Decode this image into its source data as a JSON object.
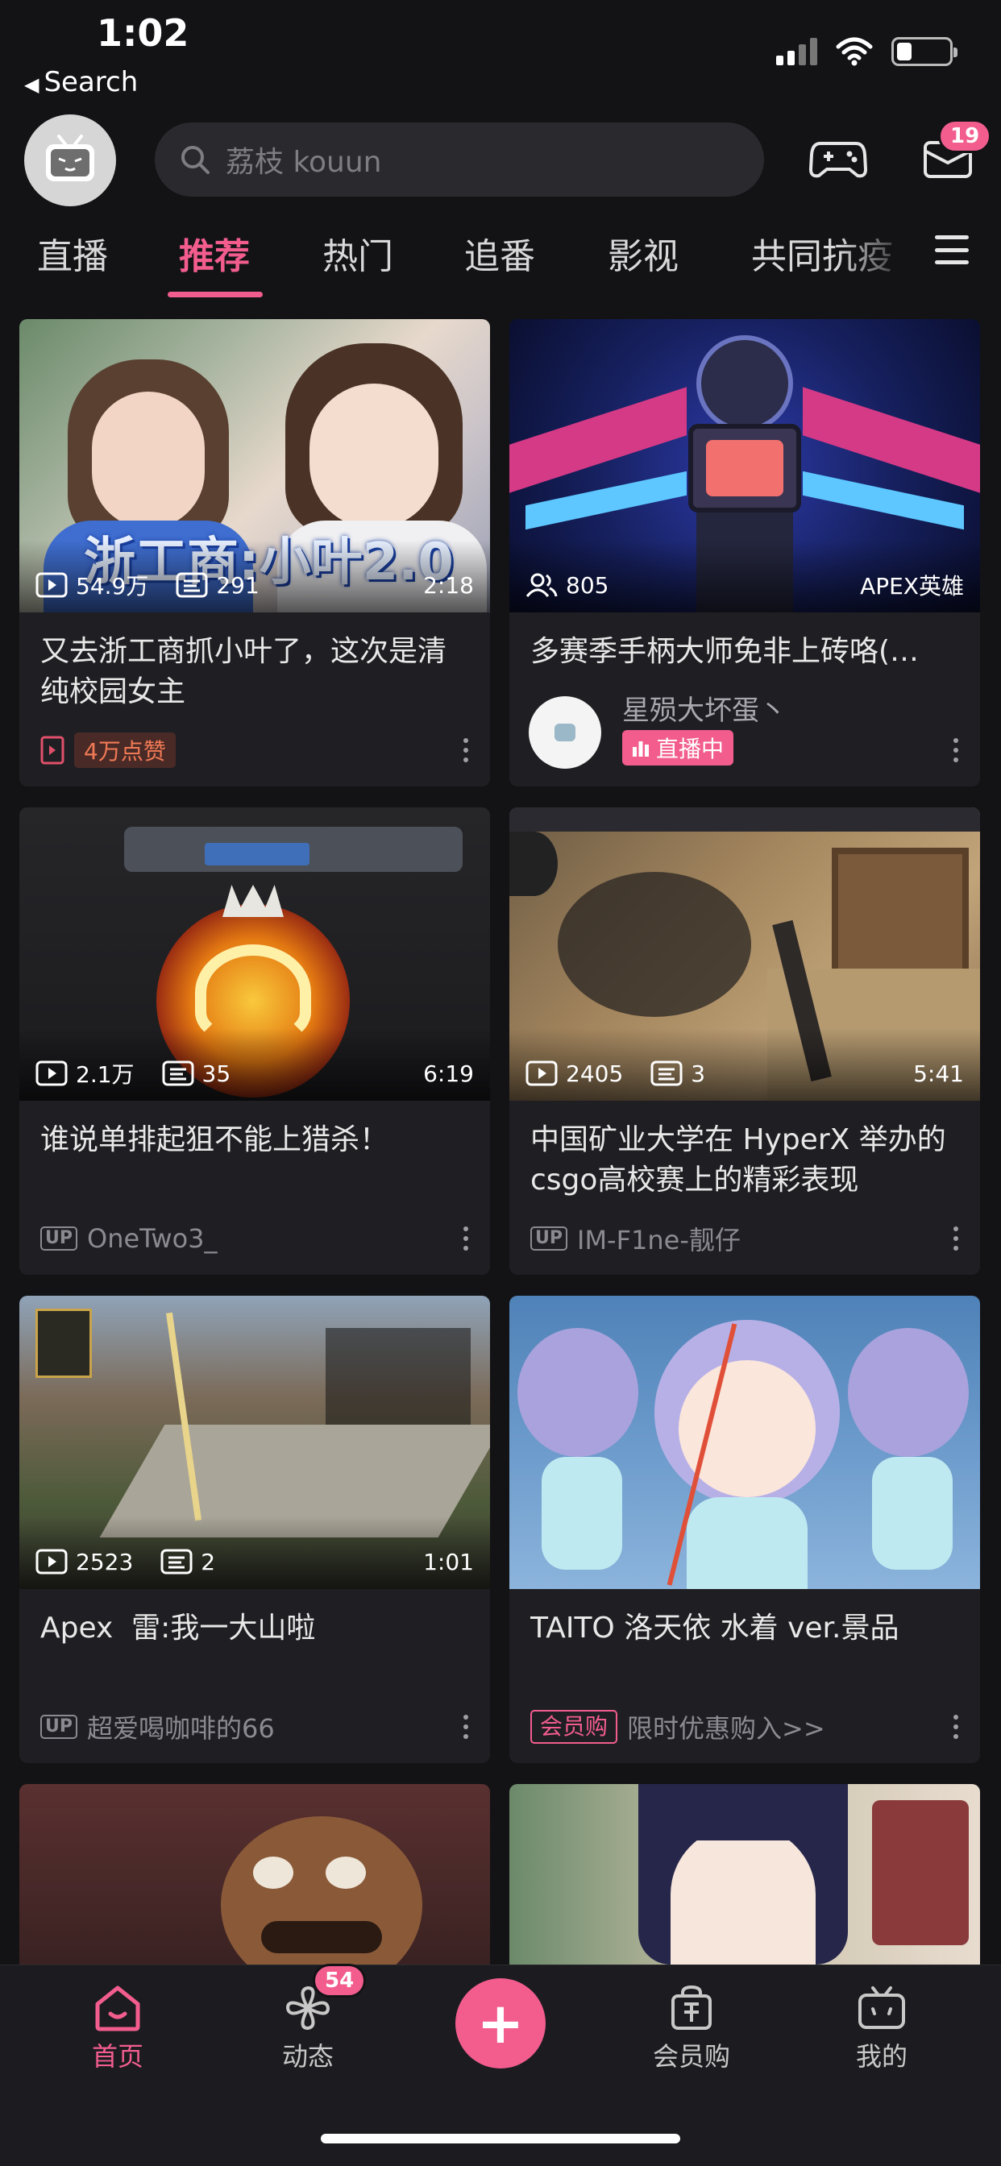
{
  "status_bar": {
    "time": "1:02",
    "back_label": "Search"
  },
  "header": {
    "search_placeholder": "荔枝 kouun",
    "messages_badge": "19"
  },
  "tabs": [
    {
      "label": "直播"
    },
    {
      "label": "推荐",
      "active": true
    },
    {
      "label": "热门"
    },
    {
      "label": "追番"
    },
    {
      "label": "影视"
    },
    {
      "label": "共同抗疫"
    }
  ],
  "feed": [
    {
      "views": "54.9万",
      "comments": "291",
      "duration": "2:18",
      "thumb_text": "浙工商:小叶2.0",
      "title": "又去浙工商抓小叶了，这次是清纯校园女主",
      "tag": "4万点赞"
    },
    {
      "viewers": "805",
      "category": "APEX英雄",
      "title": "多赛季手柄大师免非上砖咯(…",
      "streamer": "星殒大坏蛋丶",
      "live_label": "直播中"
    },
    {
      "views": "2.1万",
      "comments": "35",
      "duration": "6:19",
      "title": "谁说单排起狙不能上猎杀！",
      "up_name": "OneTwo3_"
    },
    {
      "views": "2405",
      "comments": "3",
      "duration": "5:41",
      "title": "中国矿业大学在 HyperX 举办的csgo高校赛上的精彩表现",
      "up_name": "IM-F1ne-靓仔"
    },
    {
      "views": "2523",
      "comments": "2",
      "duration": "1:01",
      "title": "Apex  雷:我一大山啦",
      "up_name": "超爱喝咖啡的66"
    },
    {
      "title": "TAITO 洛天依 水着 ver.景品",
      "promo_tag": "会员购",
      "promo_text": "限时优惠购入>>"
    }
  ],
  "up_label": "UP",
  "bottom_nav": {
    "home": "首页",
    "dynamic": "动态",
    "dynamic_badge": "54",
    "plus": "+",
    "shop": "会员购",
    "mine": "我的"
  },
  "colors": {
    "accent": "#f25d8e",
    "background": "#131316",
    "card": "#1f1f23"
  }
}
